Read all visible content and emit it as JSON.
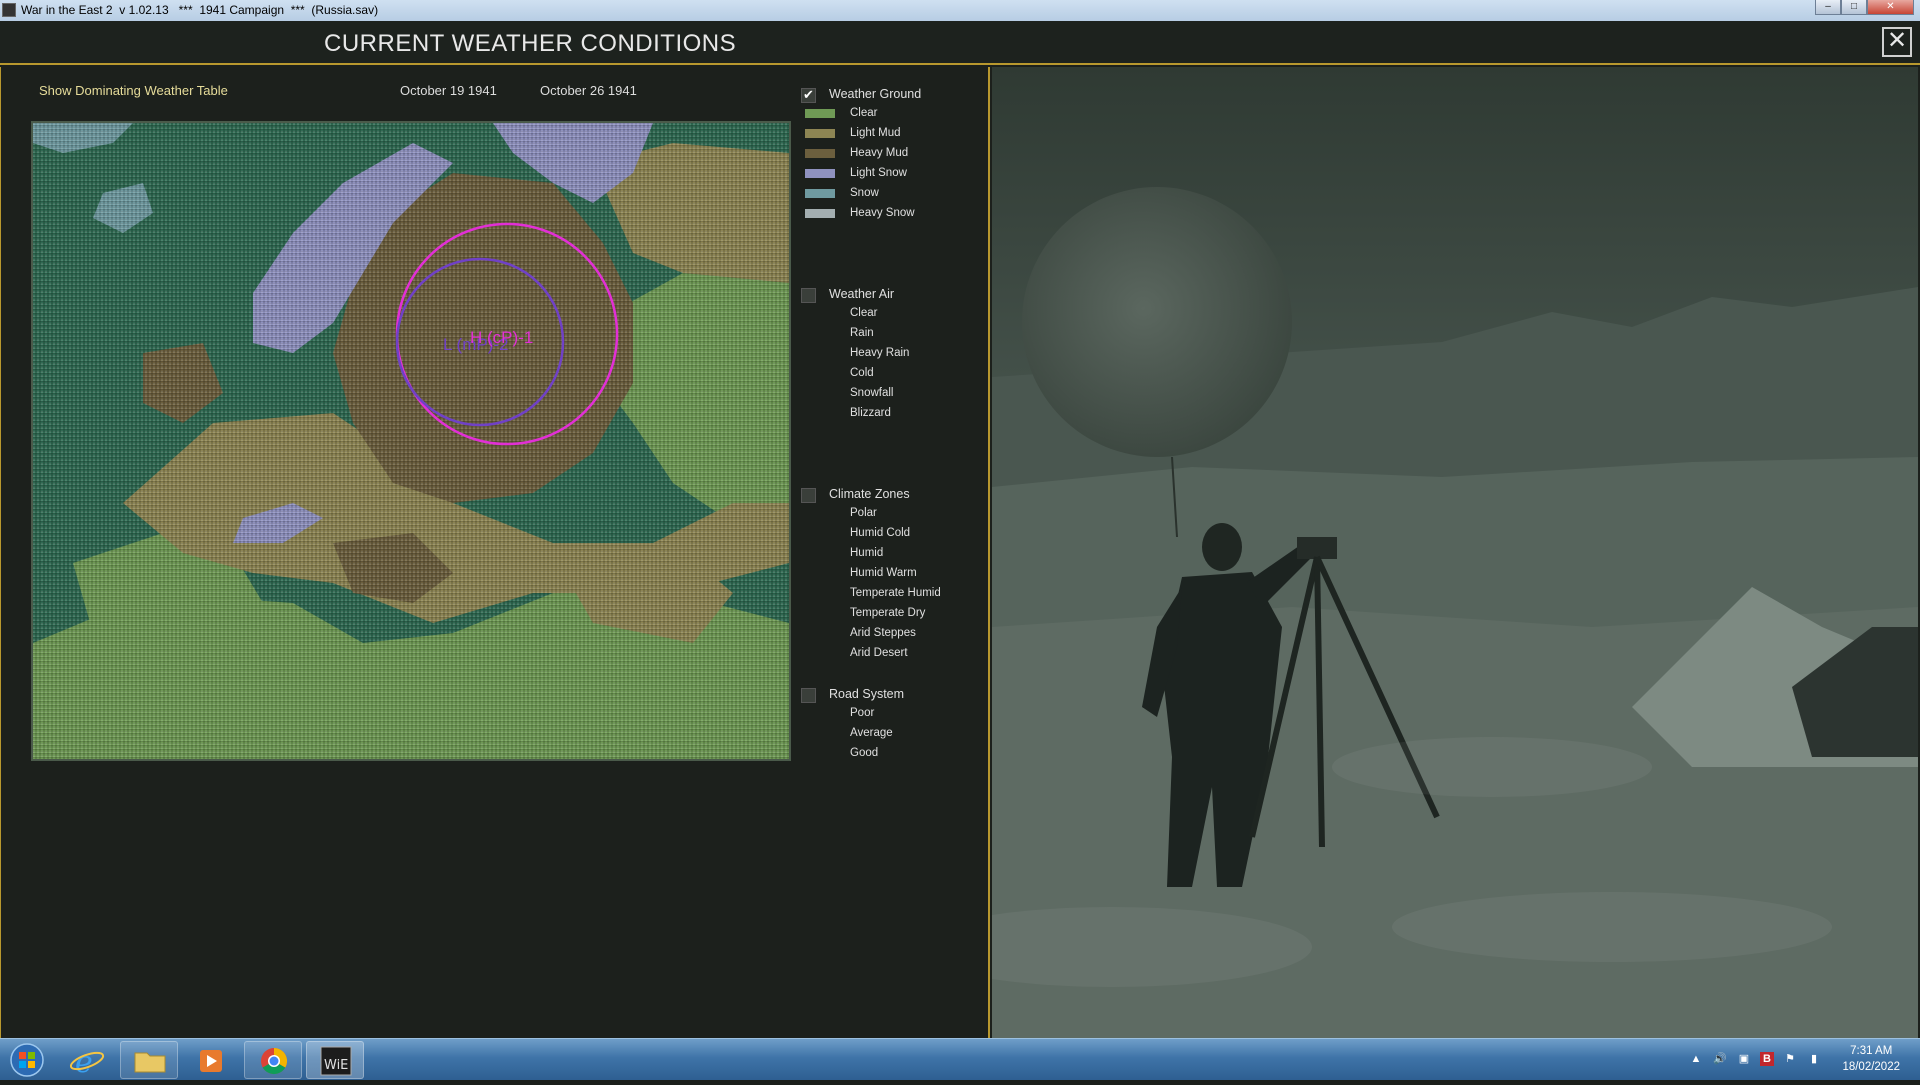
{
  "titlebar": {
    "text": "War in the East 2  v 1.02.13   ***  1941 Campaign  ***  (Russia.sav)",
    "minimize": "–",
    "maximize": "□",
    "close": "✕"
  },
  "header": {
    "title": "CURRENT WEATHER CONDITIONS",
    "close_glyph": "✕"
  },
  "topbar": {
    "show_table": "Show Dominating Weather Table",
    "date_start": "October  19  1941",
    "date_end": "October  26  1941"
  },
  "map": {
    "label_high": "H (cP)-1",
    "label_low": "L (mP)-2",
    "colors": {
      "sea": "#2f6a52",
      "clear": "#6f9a55",
      "light_mud": "#8d8553",
      "heavy_mud": "#6c5f3e",
      "light_snow": "#8f92bf",
      "snow": "#6f9aa0",
      "heavy_snow": "#a3aeb0",
      "high_circle": "#e22fd6",
      "low_circle": "#7041c6"
    }
  },
  "legend": {
    "weather_ground": {
      "label": "Weather Ground",
      "checked": true,
      "items": [
        {
          "label": "Clear",
          "color": "#6f9a55"
        },
        {
          "label": "Light Mud",
          "color": "#8d8553"
        },
        {
          "label": "Heavy Mud",
          "color": "#6c5f3e"
        },
        {
          "label": "Light Snow",
          "color": "#8f92bf"
        },
        {
          "label": "Snow",
          "color": "#6f9aa0"
        },
        {
          "label": "Heavy Snow",
          "color": "#a3aeb0"
        }
      ]
    },
    "weather_air": {
      "label": "Weather Air",
      "checked": false,
      "items": [
        "Clear",
        "Rain",
        "Heavy Rain",
        "Cold",
        "Snowfall",
        "Blizzard"
      ]
    },
    "climate_zones": {
      "label": "Climate Zones",
      "checked": false,
      "items": [
        "Polar",
        "Humid Cold",
        "Humid",
        "Humid Warm",
        "Temperate Humid",
        "Temperate Dry",
        "Arid Steppes",
        "Arid Desert"
      ]
    },
    "road_system": {
      "label": "Road System",
      "checked": false,
      "items": [
        "Poor",
        "Average",
        "Good"
      ]
    }
  },
  "taskbar": {
    "buttons": [
      "start-orb",
      "internet-explorer",
      "file-explorer",
      "media-player",
      "chrome",
      "war-in-the-east-2"
    ],
    "tray_icons": [
      "show-hidden-icon",
      "volume-icon",
      "network-icon",
      "b-icon",
      "flag-icon",
      "signal-icon"
    ],
    "time": "7:31 AM",
    "date": "18/02/2022"
  }
}
